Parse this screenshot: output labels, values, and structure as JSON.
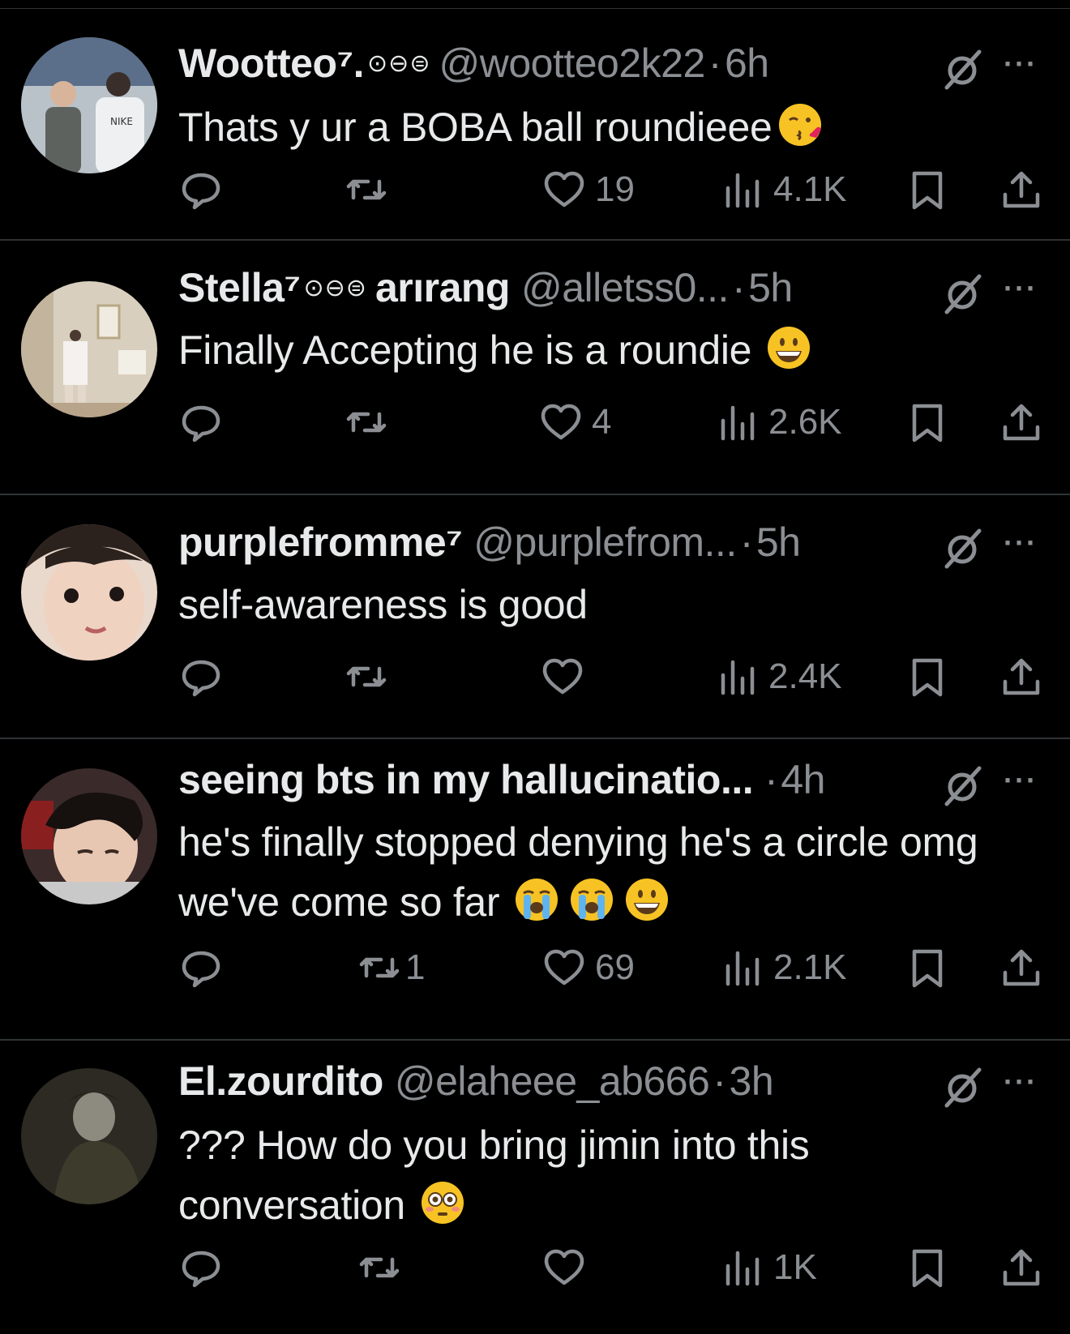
{
  "tweets": [
    {
      "name": "Wootteo⁷.",
      "badges": "⊙⊖⊜",
      "handle": "@wootteo2k22",
      "dot": "·",
      "time": "6h",
      "text": "Thats y ur a BOBA ball roundieee",
      "emojis": [
        "kissing-heart-emoji"
      ],
      "replies": "",
      "retweets": "",
      "likes": "19",
      "views": "4.1K"
    },
    {
      "name": "Stella⁷",
      "badges": "⊙⊖⊜",
      "name_suffix": "arırang",
      "handle": "@alletss0...",
      "dot": "·",
      "time": "5h",
      "text": "Finally Accepting he is a roundie",
      "emojis": [
        "grinning-emoji"
      ],
      "replies": "",
      "retweets": "",
      "likes": "4",
      "views": "2.6K"
    },
    {
      "name": "purplefromme⁷",
      "handle": "@purplefrom...",
      "dot": "·",
      "time": "5h",
      "text": "self-awareness is good",
      "emojis": [],
      "replies": "",
      "retweets": "",
      "likes": "",
      "views": "2.4K"
    },
    {
      "name": "seeing bts in my hallucinatio...",
      "handle": "",
      "dot": "·",
      "time": "4h",
      "text": "he's finally stopped denying he's a circle omg we've come so far",
      "emojis": [
        "loudly-crying-emoji",
        "loudly-crying-emoji",
        "grinning-emoji"
      ],
      "replies": "",
      "retweets": "1",
      "likes": "69",
      "views": "2.1K"
    },
    {
      "name": "El.zourdito",
      "handle": "@elaheee_ab666",
      "dot": "·",
      "time": "3h",
      "text": "??? How do you bring jimin into this conversation",
      "emojis": [
        "flushed-emoji"
      ],
      "replies": "",
      "retweets": "",
      "likes": "",
      "views": "1K"
    }
  ],
  "more_label": "···",
  "colors": {
    "background": "#000000",
    "text": "#e7e9ea",
    "muted": "#8b8f93",
    "divider": "#2f3336"
  },
  "icons": [
    "reply-icon",
    "retweet-icon",
    "like-icon",
    "views-icon",
    "bookmark-icon",
    "share-icon",
    "grok-icon",
    "more-icon"
  ]
}
